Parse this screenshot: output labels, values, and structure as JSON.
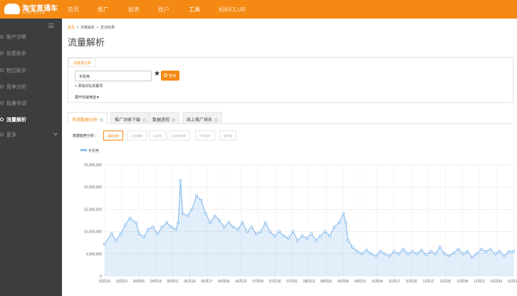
{
  "app": {
    "logo_name": "淘宝直通车",
    "logo_tagline": "淘宝推广官方工具"
  },
  "topnav": {
    "items": [
      "首页",
      "推广",
      "报表",
      "账户",
      "工具",
      "妈妈CLUB"
    ],
    "active": "工具"
  },
  "sidebar": {
    "items": [
      {
        "label": "账户诊断"
      },
      {
        "label": "创意助手"
      },
      {
        "label": "抢位助手"
      },
      {
        "label": "竞争分析"
      },
      {
        "label": "批量非调"
      },
      {
        "label": "流量解析",
        "active": true
      },
      {
        "label": "更多"
      }
    ]
  },
  "breadcrumb": [
    "首页",
    "流量解析",
    "查询结果"
  ],
  "page_title": "流量解析",
  "keyword_panel": {
    "tab_label": "关键词分析",
    "input_value": "手机壳",
    "query_label": "查询",
    "compare_label": "+ 添加对比关键词",
    "expand_label": "展开快速筛选▼"
  },
  "analysis_tabs": [
    "市场数据分析",
    "推广词表下载",
    "数据透视",
    "线上推广排名"
  ],
  "metric_row": {
    "label": "数据趋势分析：",
    "metrics": [
      "展现指数",
      "点击指数",
      "点击率",
      "点击转化率",
      "平均出价",
      "竞争度"
    ],
    "active": "展现指数"
  },
  "colors": {
    "orange": "#f48a14",
    "sidebar_bg": "#3d3d3d",
    "series": "#7cb5ec"
  },
  "icons": {
    "star": "star-icon",
    "search": "search-icon",
    "help": "help-circle-icon",
    "chevron": "chevron-down-icon"
  },
  "chart_data": {
    "type": "line",
    "series": [
      {
        "name": "手机壳"
      }
    ],
    "ylim": [
      0,
      25000000
    ],
    "yticks": [
      {
        "value": 0,
        "label": "0"
      },
      {
        "value": 5000000,
        "label": "5,000,000"
      },
      {
        "value": 10000000,
        "label": "10,000,000"
      },
      {
        "value": 15000000,
        "label": "15,000,000"
      },
      {
        "value": 20000000,
        "label": "20,000,000"
      },
      {
        "value": 25000000,
        "label": "25,000,000"
      }
    ],
    "xtick_labels": [
      "03月10",
      "03月23",
      "04月05",
      "04月18",
      "05月01",
      "05月14",
      "05月27",
      "06月09",
      "06月22",
      "07月05",
      "07月18",
      "07月31",
      "08月13",
      "08月26",
      "09月08",
      "09月21",
      "10月04",
      "10月17",
      "10月30",
      "11月12",
      "11月25",
      "12月08",
      "12月21",
      "01月03",
      "01月16"
    ],
    "anchors": [
      [
        0,
        7.2
      ],
      [
        1.5,
        9.5
      ],
      [
        2.5,
        8.0
      ],
      [
        3.5,
        9.5
      ],
      [
        4.5,
        11.5
      ],
      [
        5.5,
        13.0
      ],
      [
        6.8,
        12.0
      ],
      [
        7.5,
        9.5
      ],
      [
        8.5,
        8.8
      ],
      [
        9.5,
        10.5
      ],
      [
        10.5,
        11.0
      ],
      [
        11.5,
        9.5
      ],
      [
        12.5,
        11.0
      ],
      [
        13.5,
        12.0
      ],
      [
        14.5,
        11.0
      ],
      [
        15.5,
        10.5
      ],
      [
        16.0,
        12.0
      ],
      [
        16.5,
        21.5
      ],
      [
        17.0,
        14.0
      ],
      [
        18.0,
        13.5
      ],
      [
        19.0,
        15.0
      ],
      [
        20.0,
        18.0
      ],
      [
        21.0,
        17.0
      ],
      [
        22.0,
        14.0
      ],
      [
        23.0,
        12.0
      ],
      [
        24.0,
        13.5
      ],
      [
        25.0,
        12.5
      ],
      [
        26.0,
        11.0
      ],
      [
        27.0,
        12.0
      ],
      [
        28.0,
        11.0
      ],
      [
        29.0,
        10.5
      ],
      [
        30.0,
        12.0
      ],
      [
        31.0,
        10.0
      ],
      [
        32.0,
        11.0
      ],
      [
        33.0,
        9.5
      ],
      [
        34.0,
        10.0
      ],
      [
        35.0,
        12.0
      ],
      [
        36.0,
        10.0
      ],
      [
        37.0,
        9.0
      ],
      [
        38.0,
        10.0
      ],
      [
        39.0,
        9.0
      ],
      [
        40.0,
        8.5
      ],
      [
        41.0,
        10.0
      ],
      [
        42.0,
        8.0
      ],
      [
        43.0,
        9.0
      ],
      [
        44.0,
        8.5
      ],
      [
        45.0,
        9.5
      ],
      [
        46.0,
        8.0
      ],
      [
        47.0,
        9.0
      ],
      [
        48.0,
        10.0
      ],
      [
        49.0,
        9.0
      ],
      [
        50.0,
        11.0
      ],
      [
        51.0,
        12.0
      ],
      [
        52.0,
        14.0
      ],
      [
        52.5,
        12.0
      ],
      [
        53.0,
        8.0
      ],
      [
        54.0,
        6.5
      ],
      [
        55.0,
        5.5
      ],
      [
        56.0,
        5.0
      ],
      [
        57.0,
        5.8
      ],
      [
        58.0,
        5.0
      ],
      [
        59.0,
        4.5
      ],
      [
        60.0,
        5.5
      ],
      [
        61.0,
        5.0
      ],
      [
        62.0,
        4.5
      ],
      [
        63.0,
        5.5
      ],
      [
        64.0,
        5.0
      ],
      [
        65.0,
        6.0
      ],
      [
        66.0,
        5.0
      ],
      [
        67.0,
        5.5
      ],
      [
        68.0,
        5.0
      ],
      [
        69.0,
        5.8
      ],
      [
        70.0,
        4.8
      ],
      [
        71.0,
        5.5
      ],
      [
        72.0,
        5.0
      ],
      [
        73.0,
        6.5
      ],
      [
        74.0,
        5.0
      ],
      [
        75.0,
        4.5
      ],
      [
        76.0,
        5.2
      ],
      [
        77.0,
        6.0
      ],
      [
        78.0,
        5.0
      ],
      [
        79.0,
        5.5
      ],
      [
        80.0,
        4.2
      ],
      [
        81.0,
        5.0
      ],
      [
        82.0,
        6.0
      ],
      [
        83.0,
        5.5
      ],
      [
        84.0,
        6.0
      ],
      [
        85.0,
        5.0
      ],
      [
        86.0,
        5.5
      ],
      [
        87.0,
        4.5
      ],
      [
        88.0,
        5.5
      ],
      [
        89.0,
        5.5
      ]
    ]
  }
}
